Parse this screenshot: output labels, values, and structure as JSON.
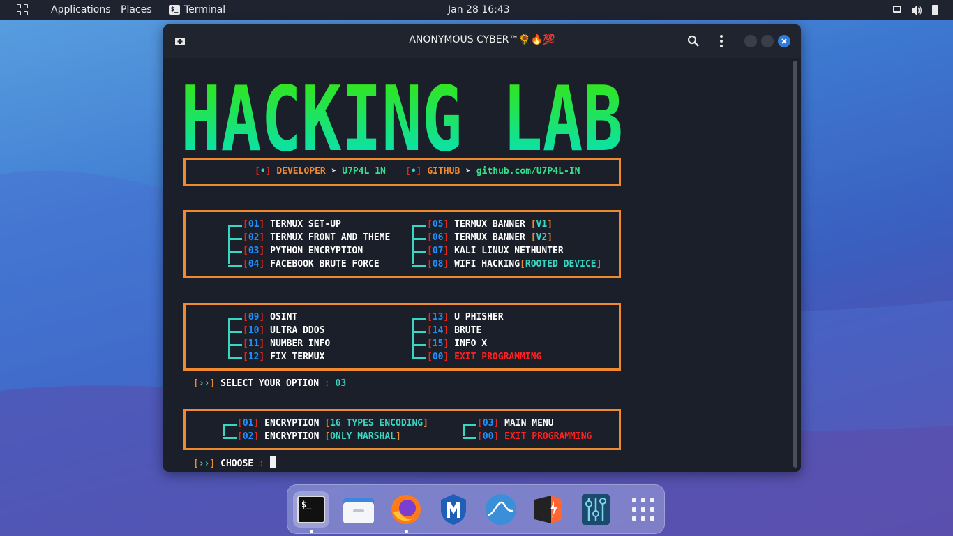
{
  "topbar": {
    "applications": "Applications",
    "places": "Places",
    "terminal": "Terminal",
    "datetime": "Jan 28  16:43"
  },
  "window": {
    "title": "ANONYMOUS CYBER™🌻🔥💯"
  },
  "banner": {
    "text": "HACKING LAB",
    "gradient_top": "#39e600",
    "gradient_bottom": "#00e0d0"
  },
  "info": {
    "dev_label": "DEVELOPER",
    "dev_value": "U7P4L 1N",
    "gh_label": "GITHUB",
    "gh_value": "github.com/U7P4L-IN"
  },
  "menu1": [
    {
      "num": "01",
      "label": "TERMUX SET-UP",
      "extra": ""
    },
    {
      "num": "02",
      "label": "TERMUX FRONT AND THEME",
      "extra": ""
    },
    {
      "num": "03",
      "label": "PYTHON ENCRYPTION",
      "extra": ""
    },
    {
      "num": "04",
      "label": "FACEBOOK BRUTE FORCE",
      "extra": ""
    },
    {
      "num": "05",
      "label": "TERMUX BANNER",
      "extra": "V1"
    },
    {
      "num": "06",
      "label": "TERMUX BANNER",
      "extra": "V2"
    },
    {
      "num": "07",
      "label": "KALI LINUX NETHUNTER",
      "extra": ""
    },
    {
      "num": "08",
      "label": "WIFI HACKING",
      "extra": "ROOTED DEVICE"
    }
  ],
  "menu2": [
    {
      "num": "09",
      "label": "OSINT"
    },
    {
      "num": "10",
      "label": "ULTRA DDOS"
    },
    {
      "num": "11",
      "label": "NUMBER INFO"
    },
    {
      "num": "12",
      "label": "FIX TERMUX"
    },
    {
      "num": "13",
      "label": "U PHISHER"
    },
    {
      "num": "14",
      "label": "BRUTE"
    },
    {
      "num": "15",
      "label": "INFO X"
    },
    {
      "num": "00",
      "label": "EXIT PROGRAMMING"
    }
  ],
  "prompt1": {
    "label": "SELECT YOUR OPTION",
    "value": "03"
  },
  "menu3": [
    {
      "num": "01",
      "label": "ENCRYPTION",
      "extra": "16 TYPES ENCODING"
    },
    {
      "num": "02",
      "label": "ENCRYPTION",
      "extra": "ONLY MARSHAL"
    },
    {
      "num": "03",
      "label": "MAIN MENU",
      "extra": ""
    },
    {
      "num": "00",
      "label": "EXIT PROGRAMMING",
      "extra": ""
    }
  ],
  "prompt2": {
    "label": "CHOOSE"
  },
  "dock": [
    "terminal",
    "files",
    "firefox",
    "metasploit",
    "wireshark",
    "burpsuite",
    "settings",
    "app-grid"
  ]
}
